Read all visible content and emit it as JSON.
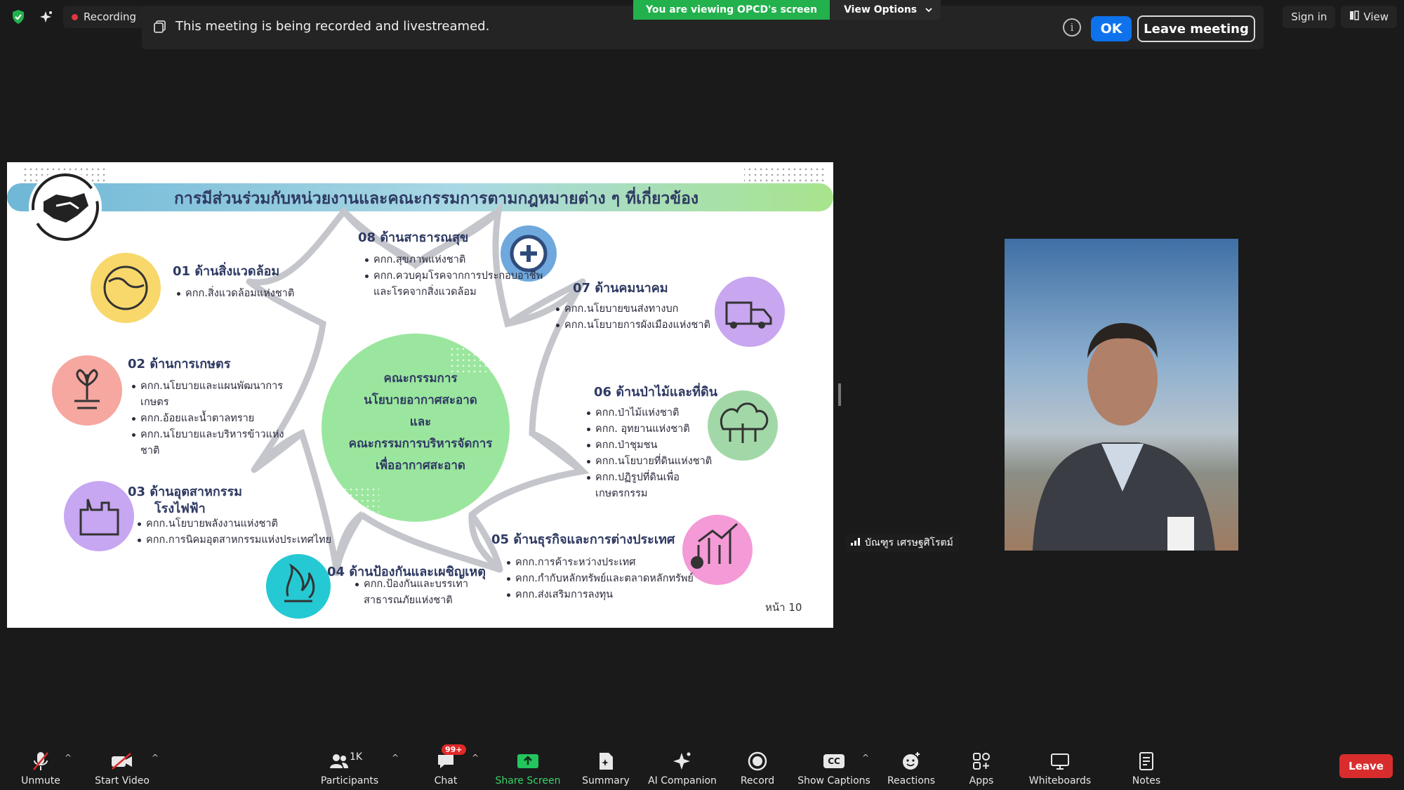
{
  "top_bar": {
    "recording_label": "Recording",
    "banner_text": "This meeting is being recorded and livestreamed.",
    "ok_label": "OK",
    "leave_meeting_label": "Leave meeting",
    "viewing_text": "You are viewing OPCD's screen",
    "view_options_label": "View Options",
    "sign_in_label": "Sign in",
    "view_label": "View"
  },
  "slide": {
    "title": "การมีส่วนร่วมกับหน่วยงานและคณะกรรมการตามกฎหมายต่าง ๆ ที่เกี่ยวข้อง",
    "center_lines": [
      "คณะกรรมการ",
      "นโยบายอากาศสะอาด",
      "และ",
      "คณะกรรมการบริหารจัดการ",
      "เพื่ออากาศสะอาด"
    ],
    "categories": [
      {
        "title": "01 ด้านสิ่งแวดล้อม",
        "items": [
          "คกก.สิ่งแวดล้อมแห่งชาติ"
        ]
      },
      {
        "title": "02 ด้านการเกษตร",
        "items": [
          "คกก.นโยบายและแผนพัฒนาการเกษตร",
          "คกก.อ้อยและน้ำตาลทราย",
          "คกก.นโยบายและบริหารข้าวแห่งชาติ"
        ]
      },
      {
        "title": "03 ด้านอุตสาหกรรม",
        "title2": "โรงไฟฟ้า",
        "items": [
          "คกก.นโยบายพลังงานแห่งชาติ",
          "คกก.การนิคมอุตสาหกรรมแห่งประเทศไทย"
        ]
      },
      {
        "title": "04 ด้านป้องกันและเผชิญเหตุ",
        "items": [
          "คกก.ป้องกันและบรรเทาสาธารณภัยแห่งชาติ"
        ]
      },
      {
        "title": "05 ด้านธุรกิจและการต่างประเทศ",
        "items": [
          "คกก.การค้าระหว่างประเทศ",
          "คกก.กำกับหลักทรัพย์และตลาดหลักทรัพย์",
          "คกก.ส่งเสริมการลงทุน"
        ]
      },
      {
        "title": "06 ด้านป่าไม้และที่ดิน",
        "items": [
          "คกก.ป่าไม้แห่งชาติ",
          "คกก. อุทยานแห่งชาติ",
          "คกก.ป่าชุมชน",
          "คกก.นโยบายที่ดินแห่งชาติ",
          "คกก.ปฏิรูปที่ดินเพื่อเกษตรกรรม"
        ]
      },
      {
        "title": "07 ด้านคมนาคม",
        "items": [
          "คกก.นโยบายขนส่งทางบก",
          "คกก.นโยบายการผังเมืองแห่งชาติ"
        ]
      },
      {
        "title": "08 ด้านสาธารณสุข",
        "items": [
          "คกก.สุขภาพแห่งชาติ",
          "คกก.ควบคุมโรคจากการประกอบอาชีพและโรคจากสิ่งแวดล้อม"
        ]
      }
    ],
    "page_label": "หน้า 10"
  },
  "speaker": {
    "name": "บัณฑูร เศรษฐศิโรตม์"
  },
  "toolbar": {
    "unmute": "Unmute",
    "start_video": "Start Video",
    "participants": "Participants",
    "participants_count": "1K",
    "chat": "Chat",
    "chat_badge": "99+",
    "share_screen": "Share Screen",
    "summary": "Summary",
    "ai_companion": "AI Companion",
    "record": "Record",
    "show_captions": "Show Captions",
    "captions_icon_text": "CC",
    "reactions": "Reactions",
    "apps": "Apps",
    "whiteboards": "Whiteboards",
    "notes": "Notes",
    "leave": "Leave"
  }
}
